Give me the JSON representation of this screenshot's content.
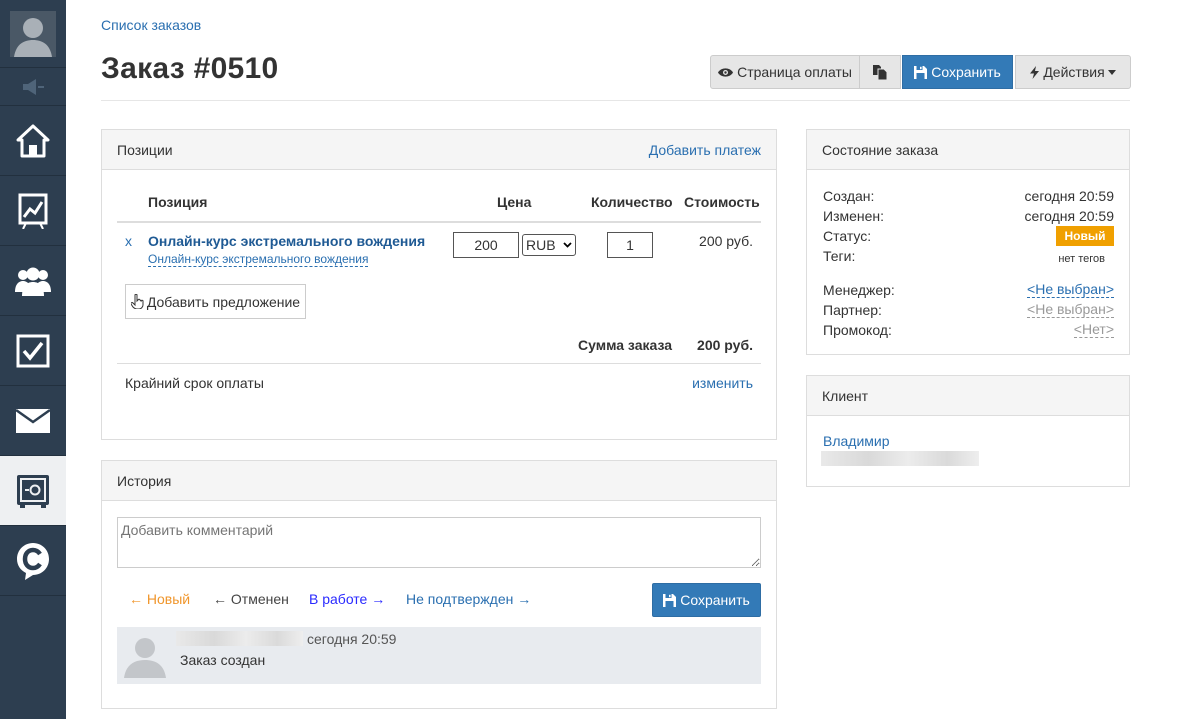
{
  "sidebar": {
    "items": [
      {
        "name": "user-avatar-icon"
      },
      {
        "name": "megaphone-icon"
      },
      {
        "name": "home-icon"
      },
      {
        "name": "chart-icon"
      },
      {
        "name": "users-icon"
      },
      {
        "name": "checkbox-icon"
      },
      {
        "name": "mail-icon"
      },
      {
        "name": "safe-icon",
        "active": true
      },
      {
        "name": "c-logo-icon"
      }
    ]
  },
  "header": {
    "breadcrumb": "Список заказов",
    "title": "Заказ #0510",
    "buttons": {
      "payment_page": "Страница оплаты",
      "save": "Сохранить",
      "actions": "Действия"
    }
  },
  "positions": {
    "title": "Позиции",
    "add_payment": "Добавить платеж",
    "columns": {
      "position": "Позиция",
      "price": "Цена",
      "quantity": "Количество",
      "cost": "Стоимость"
    },
    "rows": [
      {
        "remove": "x",
        "name": "Онлайн-курс экстремального вождения",
        "sublink": "Онлайн-курс экстремального вождения",
        "price": "200",
        "currency": "RUB",
        "quantity": "1",
        "cost": "200 руб."
      }
    ],
    "add_offer": "Добавить предложение",
    "total_label": "Сумма заказа",
    "total_value": "200 руб.",
    "deadline_label": "Крайний срок оплаты",
    "deadline_change": "изменить"
  },
  "history": {
    "title": "История",
    "comment_placeholder": "Добавить комментарий",
    "statuses": {
      "new": "← Новый",
      "cancelled": "← Отменен",
      "in_work": "В работе →",
      "unconfirmed": "Не подтвержден →"
    },
    "save": "Сохранить",
    "entry": {
      "time": "сегодня 20:59",
      "text": "Заказ создан"
    }
  },
  "order_state": {
    "title": "Состояние заказа",
    "created_label": "Создан:",
    "created_value": "сегодня 20:59",
    "changed_label": "Изменен:",
    "changed_value": "сегодня 20:59",
    "status_label": "Статус:",
    "status_value": "Новый",
    "tags_label": "Теги:",
    "tags_value": "нет тегов",
    "manager_label": "Менеджер:",
    "manager_value": "<Не выбран>",
    "partner_label": "Партнер:",
    "partner_value": "<Не выбран>",
    "promo_label": "Промокод:",
    "promo_value": "<Нет>"
  },
  "client": {
    "title": "Клиент",
    "name": "Владимир"
  },
  "colors": {
    "sidebar": "#2d3e50",
    "primary": "#337ab7",
    "link": "#2a6fb0",
    "status_new": "#f0a000",
    "status_orange": "#f0962c",
    "status_blue": "#2a2aff"
  }
}
